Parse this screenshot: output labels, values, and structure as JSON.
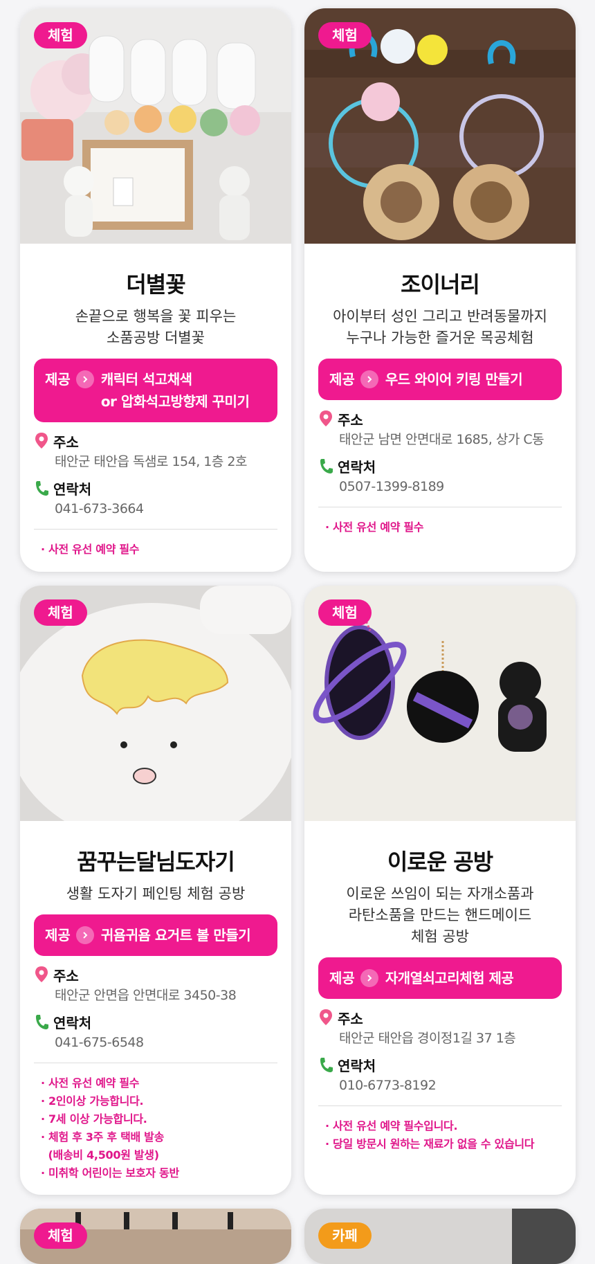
{
  "colors": {
    "accent": "#ef1a8f",
    "cafe": "#f39b1a"
  },
  "labels": {
    "provide": "제공",
    "address": "주소",
    "contact": "연락처"
  },
  "cards": [
    {
      "badge": "체험",
      "title": "더별꽃",
      "desc": [
        "손끝으로 행복을 꽃 피우는",
        "소품공방 더별꽃"
      ],
      "provide": [
        "캐릭터 석고채색",
        "or 압화석고방향제 꾸미기"
      ],
      "address": "태안군 태안읍 독샘로 154, 1층 2호",
      "phone": "041-673-3664",
      "notes": [
        "· 사전 유선 예약 필수"
      ]
    },
    {
      "badge": "체험",
      "title": "조이너리",
      "desc": [
        "아이부터 성인 그리고 반려동물까지",
        "누구나 가능한 즐거운 목공체험"
      ],
      "provide": [
        "우드 와이어 키링 만들기"
      ],
      "address": "태안군 남면 안면대로 1685, 상가 C동",
      "phone": "0507-1399-8189",
      "notes": [
        "· 사전 유선 예약 필수"
      ]
    },
    {
      "badge": "체험",
      "title": "꿈꾸는달님도자기",
      "desc": [
        "생활 도자기 페인팅 체험 공방"
      ],
      "provide": [
        "귀욤귀욤 요거트 볼 만들기"
      ],
      "address": "태안군 안면읍 안면대로 3450-38",
      "phone": "041-675-6548",
      "notes": [
        "· 사전 유선 예약 필수",
        "· 2인이상 가능합니다.",
        "· 7세 이상 가능합니다.",
        "· 체험 후 3주 후 택배 발송",
        "  (배송비 4,500원 발생)",
        "· 미취학 어린이는 보호자 동반"
      ]
    },
    {
      "badge": "체험",
      "title": "이로운 공방",
      "desc": [
        "이로운 쓰임이 되는 자개소품과",
        "라탄소품을 만드는 핸드메이드",
        "체험 공방"
      ],
      "provide": [
        "자개열쇠고리체험 제공"
      ],
      "address": "태안군 태안읍 경이정1길 37 1층",
      "phone": "010-6773-8192",
      "notes": [
        "· 사전 유선 예약 필수입니다.",
        "· 당일 방문시 원하는 재료가 없을 수 있습니다"
      ]
    }
  ],
  "partial": [
    {
      "badge": "체험"
    },
    {
      "badge": "카페"
    }
  ]
}
